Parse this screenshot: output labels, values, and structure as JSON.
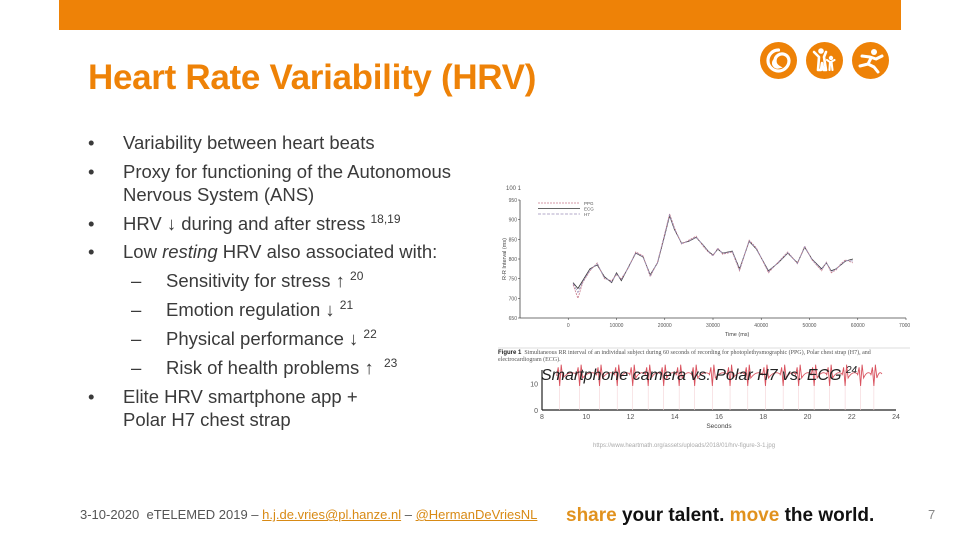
{
  "slide": {
    "title": "Heart Rate Variability (HRV)",
    "accent_color": "#ee8207",
    "logos": [
      "spiral-icon",
      "parent-child-icon",
      "running-person-icon"
    ]
  },
  "bullets": [
    {
      "marker": "•",
      "text": "Variability between heart beats"
    },
    {
      "marker": "•",
      "text": "Proxy for functioning of the Autonomous Nervous System (ANS)"
    },
    {
      "marker": "•",
      "text": "HRV ↓ during and after stress ",
      "sup": "18,19"
    },
    {
      "marker": "•",
      "pre": "Low ",
      "em": "resting",
      "post": " HRV also associated with:"
    },
    {
      "marker": "–",
      "text": "Sensitivity for stress ↑ ",
      "sup": "20"
    },
    {
      "marker": "–",
      "text": "Emotion regulation ↓ ",
      "sup": "21"
    },
    {
      "marker": "–",
      "text": "Physical performance ↓ ",
      "sup": "22"
    },
    {
      "marker": "–",
      "text": "Risk of health problems ↑  ",
      "sup": "23"
    },
    {
      "marker": "•",
      "text": "Elite HRV smartphone app + Polar H7 chest strap"
    }
  ],
  "figure": {
    "caption_label": "Figure 1",
    "caption_text": "Simultaneous RR interval of an individual subject during 60 seconds of recording for photoplethysmographic (PPG), Polar chest strap (H7), and electrocardiogram (ECG).",
    "overlay_text": "Smartphone camera vs. Polar H7 vs. ECG ",
    "overlay_sup": "24",
    "source": "https://www.heartmath.org/assets/uploads/2018/01/hrv-figure-3-1.jpg"
  },
  "chart_data": [
    {
      "type": "line",
      "title": "",
      "panel_label": "100 1",
      "xlabel": "Time (ms)",
      "ylabel": "R-R Interval (ms)",
      "xlim": [
        -10000,
        70000
      ],
      "ylim": [
        650,
        950
      ],
      "xticks": [
        0,
        10000,
        20000,
        30000,
        40000,
        50000,
        60000,
        70000
      ],
      "yticks": [
        650,
        700,
        750,
        800,
        850,
        900,
        950
      ],
      "legend": [
        "PPG",
        "ECG",
        "H7"
      ],
      "legend_position": "top-left",
      "x": [
        1000,
        2000,
        3000,
        4500,
        6000,
        7500,
        9000,
        10000,
        11000,
        12500,
        14000,
        15500,
        17000,
        18500,
        20000,
        21000,
        22000,
        23500,
        25000,
        26500,
        28000,
        29000,
        30000,
        31000,
        32000,
        34000,
        35500,
        37500,
        39000,
        41500,
        43500,
        45500,
        47500,
        49000,
        50500,
        52500,
        53500,
        54500,
        55500,
        56500,
        57500,
        59000
      ],
      "series": [
        {
          "name": "ECG",
          "values": [
            740,
            725,
            745,
            775,
            785,
            755,
            740,
            765,
            745,
            780,
            815,
            805,
            760,
            790,
            860,
            910,
            875,
            840,
            845,
            855,
            835,
            820,
            810,
            825,
            815,
            820,
            775,
            845,
            825,
            770,
            790,
            815,
            790,
            830,
            800,
            775,
            790,
            770,
            775,
            785,
            795,
            800
          ]
        },
        {
          "name": "PPG",
          "values": [
            735,
            700,
            740,
            770,
            790,
            750,
            745,
            760,
            750,
            778,
            818,
            808,
            755,
            792,
            865,
            915,
            880,
            838,
            848,
            858,
            832,
            818,
            808,
            828,
            812,
            818,
            770,
            848,
            828,
            765,
            792,
            818,
            788,
            833,
            798,
            770,
            792,
            765,
            772,
            788,
            798,
            790
          ]
        },
        {
          "name": "H7",
          "values": [
            738,
            715,
            742,
            772,
            788,
            752,
            742,
            762,
            748,
            779,
            816,
            806,
            758,
            791,
            862,
            912,
            877,
            839,
            846,
            856,
            834,
            819,
            809,
            826,
            814,
            819,
            773,
            846,
            826,
            768,
            791,
            816,
            789,
            831,
            799,
            773,
            791,
            768,
            774,
            786,
            796,
            795
          ]
        }
      ]
    },
    {
      "type": "line",
      "title": "",
      "xlabel": "Seconds",
      "ylabel": "",
      "xlim": [
        8,
        24
      ],
      "ylim": [
        0,
        15
      ],
      "xticks": [
        8,
        10,
        12,
        14,
        16,
        18,
        20,
        22,
        24
      ],
      "yticks": [
        0,
        10
      ],
      "series": [
        {
          "name": "ECG trace",
          "beat_times": [
            8.8,
            9.7,
            10.6,
            11.4,
            12.1,
            12.8,
            13.5,
            14.2,
            14.9,
            15.7,
            16.5,
            17.3,
            18.1,
            18.9,
            19.6,
            20.3,
            21.0,
            21.7,
            22.4,
            23.0
          ]
        }
      ]
    }
  ],
  "footer": {
    "date": "3-10-2020",
    "event": "eTELEMED 2019 –",
    "email": "h.j.de.vries@pl.hanze.nl",
    "sep": "–",
    "twitter": "@HermanDeVriesNL",
    "slogan_1": "share",
    "slogan_2": " your talent. ",
    "slogan_3": "move",
    "slogan_4": " the world.",
    "page_number": "7"
  }
}
